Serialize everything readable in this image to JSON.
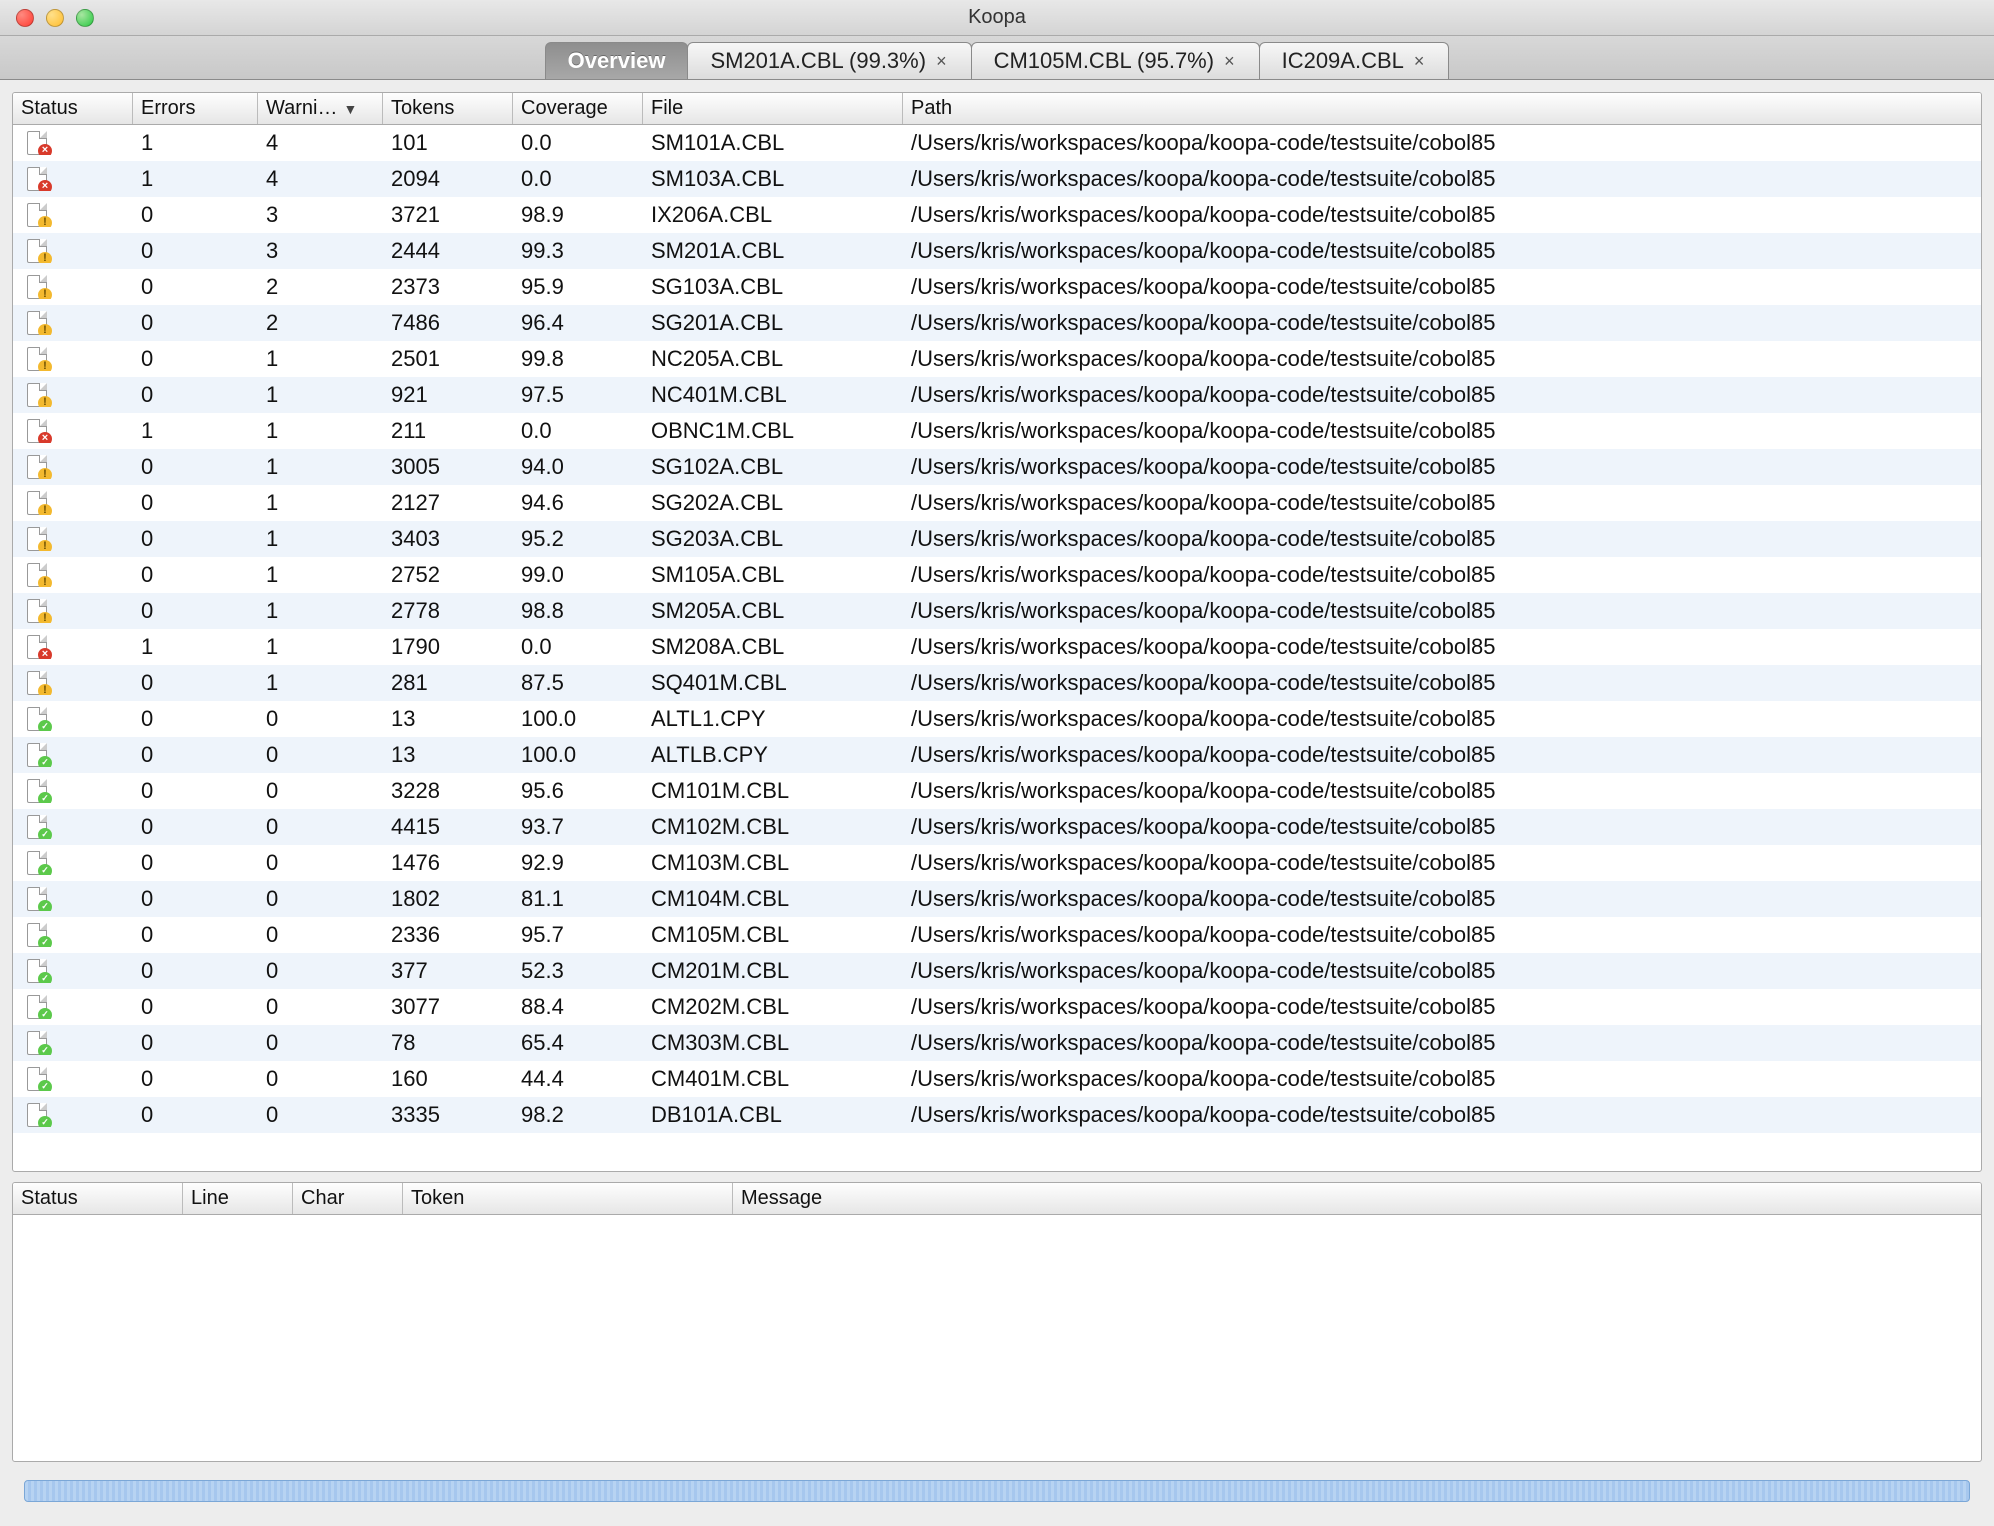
{
  "window": {
    "title": "Koopa"
  },
  "tabs": [
    {
      "label": "Overview",
      "closable": false,
      "active": true
    },
    {
      "label": "SM201A.CBL (99.3%)",
      "closable": true,
      "active": false
    },
    {
      "label": "CM105M.CBL (95.7%)",
      "closable": true,
      "active": false
    },
    {
      "label": "IC209A.CBL",
      "closable": true,
      "active": false
    }
  ],
  "main_table": {
    "columns": {
      "status": "Status",
      "errors": "Errors",
      "warnings": "Warni…",
      "tokens": "Tokens",
      "coverage": "Coverage",
      "file": "File",
      "path": "Path"
    },
    "sort": {
      "column": "warnings",
      "dir": "desc",
      "glyph": "▼"
    },
    "rows": [
      {
        "status": "err",
        "errors": 1,
        "warnings": 4,
        "tokens": 101,
        "coverage": "0.0",
        "file": "SM101A.CBL",
        "path": "/Users/kris/workspaces/koopa/koopa-code/testsuite/cobol85"
      },
      {
        "status": "err",
        "errors": 1,
        "warnings": 4,
        "tokens": 2094,
        "coverage": "0.0",
        "file": "SM103A.CBL",
        "path": "/Users/kris/workspaces/koopa/koopa-code/testsuite/cobol85"
      },
      {
        "status": "warn",
        "errors": 0,
        "warnings": 3,
        "tokens": 3721,
        "coverage": "98.9",
        "file": "IX206A.CBL",
        "path": "/Users/kris/workspaces/koopa/koopa-code/testsuite/cobol85"
      },
      {
        "status": "warn",
        "errors": 0,
        "warnings": 3,
        "tokens": 2444,
        "coverage": "99.3",
        "file": "SM201A.CBL",
        "path": "/Users/kris/workspaces/koopa/koopa-code/testsuite/cobol85"
      },
      {
        "status": "warn",
        "errors": 0,
        "warnings": 2,
        "tokens": 2373,
        "coverage": "95.9",
        "file": "SG103A.CBL",
        "path": "/Users/kris/workspaces/koopa/koopa-code/testsuite/cobol85"
      },
      {
        "status": "warn",
        "errors": 0,
        "warnings": 2,
        "tokens": 7486,
        "coverage": "96.4",
        "file": "SG201A.CBL",
        "path": "/Users/kris/workspaces/koopa/koopa-code/testsuite/cobol85"
      },
      {
        "status": "warn",
        "errors": 0,
        "warnings": 1,
        "tokens": 2501,
        "coverage": "99.8",
        "file": "NC205A.CBL",
        "path": "/Users/kris/workspaces/koopa/koopa-code/testsuite/cobol85"
      },
      {
        "status": "warn",
        "errors": 0,
        "warnings": 1,
        "tokens": 921,
        "coverage": "97.5",
        "file": "NC401M.CBL",
        "path": "/Users/kris/workspaces/koopa/koopa-code/testsuite/cobol85"
      },
      {
        "status": "err",
        "errors": 1,
        "warnings": 1,
        "tokens": 211,
        "coverage": "0.0",
        "file": "OBNC1M.CBL",
        "path": "/Users/kris/workspaces/koopa/koopa-code/testsuite/cobol85"
      },
      {
        "status": "warn",
        "errors": 0,
        "warnings": 1,
        "tokens": 3005,
        "coverage": "94.0",
        "file": "SG102A.CBL",
        "path": "/Users/kris/workspaces/koopa/koopa-code/testsuite/cobol85"
      },
      {
        "status": "warn",
        "errors": 0,
        "warnings": 1,
        "tokens": 2127,
        "coverage": "94.6",
        "file": "SG202A.CBL",
        "path": "/Users/kris/workspaces/koopa/koopa-code/testsuite/cobol85"
      },
      {
        "status": "warn",
        "errors": 0,
        "warnings": 1,
        "tokens": 3403,
        "coverage": "95.2",
        "file": "SG203A.CBL",
        "path": "/Users/kris/workspaces/koopa/koopa-code/testsuite/cobol85"
      },
      {
        "status": "warn",
        "errors": 0,
        "warnings": 1,
        "tokens": 2752,
        "coverage": "99.0",
        "file": "SM105A.CBL",
        "path": "/Users/kris/workspaces/koopa/koopa-code/testsuite/cobol85"
      },
      {
        "status": "warn",
        "errors": 0,
        "warnings": 1,
        "tokens": 2778,
        "coverage": "98.8",
        "file": "SM205A.CBL",
        "path": "/Users/kris/workspaces/koopa/koopa-code/testsuite/cobol85"
      },
      {
        "status": "err",
        "errors": 1,
        "warnings": 1,
        "tokens": 1790,
        "coverage": "0.0",
        "file": "SM208A.CBL",
        "path": "/Users/kris/workspaces/koopa/koopa-code/testsuite/cobol85"
      },
      {
        "status": "warn",
        "errors": 0,
        "warnings": 1,
        "tokens": 281,
        "coverage": "87.5",
        "file": "SQ401M.CBL",
        "path": "/Users/kris/workspaces/koopa/koopa-code/testsuite/cobol85"
      },
      {
        "status": "ok",
        "errors": 0,
        "warnings": 0,
        "tokens": 13,
        "coverage": "100.0",
        "file": "ALTL1.CPY",
        "path": "/Users/kris/workspaces/koopa/koopa-code/testsuite/cobol85"
      },
      {
        "status": "ok",
        "errors": 0,
        "warnings": 0,
        "tokens": 13,
        "coverage": "100.0",
        "file": "ALTLB.CPY",
        "path": "/Users/kris/workspaces/koopa/koopa-code/testsuite/cobol85"
      },
      {
        "status": "ok",
        "errors": 0,
        "warnings": 0,
        "tokens": 3228,
        "coverage": "95.6",
        "file": "CM101M.CBL",
        "path": "/Users/kris/workspaces/koopa/koopa-code/testsuite/cobol85"
      },
      {
        "status": "ok",
        "errors": 0,
        "warnings": 0,
        "tokens": 4415,
        "coverage": "93.7",
        "file": "CM102M.CBL",
        "path": "/Users/kris/workspaces/koopa/koopa-code/testsuite/cobol85"
      },
      {
        "status": "ok",
        "errors": 0,
        "warnings": 0,
        "tokens": 1476,
        "coverage": "92.9",
        "file": "CM103M.CBL",
        "path": "/Users/kris/workspaces/koopa/koopa-code/testsuite/cobol85"
      },
      {
        "status": "ok",
        "errors": 0,
        "warnings": 0,
        "tokens": 1802,
        "coverage": "81.1",
        "file": "CM104M.CBL",
        "path": "/Users/kris/workspaces/koopa/koopa-code/testsuite/cobol85"
      },
      {
        "status": "ok",
        "errors": 0,
        "warnings": 0,
        "tokens": 2336,
        "coverage": "95.7",
        "file": "CM105M.CBL",
        "path": "/Users/kris/workspaces/koopa/koopa-code/testsuite/cobol85"
      },
      {
        "status": "ok",
        "errors": 0,
        "warnings": 0,
        "tokens": 377,
        "coverage": "52.3",
        "file": "CM201M.CBL",
        "path": "/Users/kris/workspaces/koopa/koopa-code/testsuite/cobol85"
      },
      {
        "status": "ok",
        "errors": 0,
        "warnings": 0,
        "tokens": 3077,
        "coverage": "88.4",
        "file": "CM202M.CBL",
        "path": "/Users/kris/workspaces/koopa/koopa-code/testsuite/cobol85"
      },
      {
        "status": "ok",
        "errors": 0,
        "warnings": 0,
        "tokens": 78,
        "coverage": "65.4",
        "file": "CM303M.CBL",
        "path": "/Users/kris/workspaces/koopa/koopa-code/testsuite/cobol85"
      },
      {
        "status": "ok",
        "errors": 0,
        "warnings": 0,
        "tokens": 160,
        "coverage": "44.4",
        "file": "CM401M.CBL",
        "path": "/Users/kris/workspaces/koopa/koopa-code/testsuite/cobol85"
      },
      {
        "status": "ok",
        "errors": 0,
        "warnings": 0,
        "tokens": 3335,
        "coverage": "98.2",
        "file": "DB101A.CBL",
        "path": "/Users/kris/workspaces/koopa/koopa-code/testsuite/cobol85"
      }
    ]
  },
  "detail_table": {
    "columns": {
      "status": "Status",
      "line": "Line",
      "char": "Char",
      "token": "Token",
      "message": "Message"
    }
  }
}
